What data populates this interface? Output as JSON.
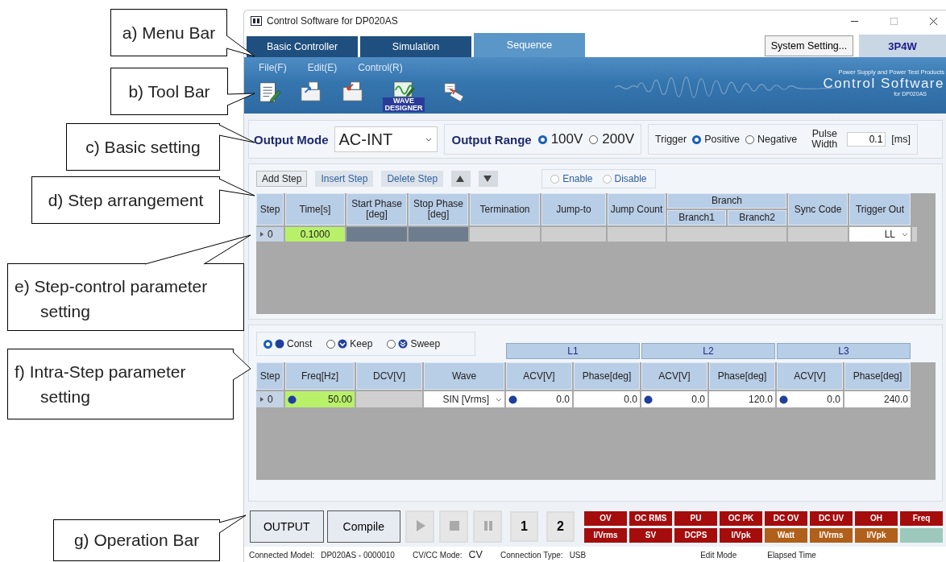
{
  "callouts": [
    {
      "label": "a) Menu Bar",
      "kind": "a"
    },
    {
      "label": "b) Tool Bar",
      "kind": "b"
    },
    {
      "label": "c) Basic setting",
      "kind": "c"
    },
    {
      "label": "d) Step arrangement",
      "kind": "d"
    },
    {
      "label": "e) Step-control parameter setting",
      "kind": "e"
    },
    {
      "label": "f) Intra-Step parameter setting",
      "kind": "f"
    },
    {
      "label": "g) Operation Bar",
      "kind": "g"
    }
  ],
  "window": {
    "title": "Control Software for DP020AS"
  },
  "tabs": [
    {
      "label": "Basic Controller",
      "selected": false
    },
    {
      "label": "Simulation",
      "selected": false
    },
    {
      "label": "Sequence",
      "selected": true
    }
  ],
  "system_setting_button": "System Setting...",
  "wiring_badge": "3P4W",
  "menu": [
    "File(F)",
    "Edit(E)",
    "Control(R)"
  ],
  "toolbar": [
    {
      "kind": "new"
    },
    {
      "kind": "open"
    },
    {
      "kind": "save"
    },
    {
      "kind": "wave",
      "caption": "WAVE DESIGNER"
    },
    {
      "kind": "transfer"
    }
  ],
  "logo": {
    "tagline": "Power Supply and Power Test Products",
    "name": "Control Software",
    "sub": "for DP020AS"
  },
  "basic_setting": {
    "output_mode_label": "Output Mode",
    "output_mode_value": "AC-INT",
    "output_range_label": "Output Range",
    "ranges": [
      {
        "label": "100V",
        "selected": true
      },
      {
        "label": "200V",
        "selected": false
      }
    ],
    "trigger_label": "Trigger",
    "triggers": [
      {
        "label": "Positive",
        "selected": true
      },
      {
        "label": "Negative",
        "selected": false
      }
    ],
    "pulse_width_label": "Pulse Width",
    "pulse_width_value": "0.1",
    "pulse_width_unit": "[ms]"
  },
  "step_arrangement": {
    "buttons": [
      {
        "label": "Add Step",
        "kind": "raised"
      },
      {
        "label": "Insert Step",
        "kind": "flat"
      },
      {
        "label": "Delete Step",
        "kind": "flat"
      }
    ],
    "move_buttons": [
      {
        "kind": "up"
      },
      {
        "kind": "down"
      }
    ],
    "sync_disabled": true,
    "sync_options": [
      {
        "label": "Enable",
        "selected": false
      },
      {
        "label": "Disable",
        "selected": false
      }
    ]
  },
  "step_table": {
    "columns": [
      {
        "label": "Step"
      },
      {
        "label": "Time[s]"
      },
      {
        "label": "Start Phase [deg]"
      },
      {
        "label": "Stop Phase [deg]"
      },
      {
        "label": "Termination"
      },
      {
        "label": "Jump-to"
      },
      {
        "label": "Jump Count"
      },
      {
        "label": "Branch",
        "children": [
          "Branch1",
          "Branch2"
        ]
      },
      {
        "label": "Sync Code"
      },
      {
        "label": "Trigger Out"
      }
    ],
    "rows": [
      {
        "cells": [
          {
            "kind": "step",
            "value": "0"
          },
          {
            "kind": "param",
            "selected": true,
            "value": "0.1000"
          },
          {
            "kind": "blocked"
          },
          {
            "kind": "blocked"
          },
          {
            "kind": "empty"
          },
          {
            "kind": "empty"
          },
          {
            "kind": "empty"
          },
          {
            "kind": "empty"
          },
          {
            "kind": "empty"
          },
          {
            "kind": "select",
            "value": "LL"
          },
          {
            "kind": "empty"
          }
        ]
      }
    ]
  },
  "intra_step": {
    "modes": [
      {
        "label": "Const",
        "kind": "const",
        "selected": true
      },
      {
        "label": "Keep",
        "kind": "keep",
        "selected": false
      },
      {
        "label": "Sweep",
        "kind": "sweep",
        "selected": false
      }
    ],
    "phases": [
      "L1",
      "L2",
      "L3"
    ],
    "columns": [
      "Step",
      "Freq[Hz]",
      "DCV[V]",
      "Wave",
      "ACV[V]",
      "Phase[deg]",
      "ACV[V]",
      "Phase[deg]",
      "ACV[V]",
      "Phase[deg]"
    ],
    "rows": [
      {
        "cells": [
          {
            "kind": "step",
            "value": "0"
          },
          {
            "kind": "const",
            "selected": true,
            "value": "50.00"
          },
          {
            "kind": "empty"
          },
          {
            "kind": "select",
            "value": "SIN [Vrms]"
          },
          {
            "kind": "const",
            "selected": false,
            "value": "0.0"
          },
          {
            "kind": "param",
            "selected": false,
            "value": "0.0"
          },
          {
            "kind": "const",
            "selected": false,
            "value": "0.0"
          },
          {
            "kind": "param",
            "selected": false,
            "value": "120.0"
          },
          {
            "kind": "const",
            "selected": false,
            "value": "0.0"
          },
          {
            "kind": "param",
            "selected": false,
            "value": "240.0"
          }
        ]
      }
    ]
  },
  "operation_bar": {
    "buttons": [
      "OUTPUT",
      "Compile"
    ],
    "transport": [
      {
        "kind": "play"
      },
      {
        "kind": "stop"
      },
      {
        "kind": "pause"
      }
    ],
    "memory": [
      "1",
      "2"
    ],
    "alarm_rows": [
      {
        "items": [
          {
            "label": "OV",
            "color": "#a50d0d"
          },
          {
            "label": "OC RMS",
            "color": "#a50d0d"
          },
          {
            "label": "PU",
            "color": "#a50d0d"
          },
          {
            "label": "OC PK",
            "color": "#a50d0d"
          },
          {
            "label": "DC OV",
            "color": "#a50d0d"
          },
          {
            "label": "DC UV",
            "color": "#a50d0d"
          },
          {
            "label": "OH",
            "color": "#a50d0d"
          },
          {
            "label": "Freq",
            "color": "#a50d0d"
          }
        ]
      },
      {
        "items": [
          {
            "label": "I/Vrms",
            "color": "#a50d0d"
          },
          {
            "label": "SV",
            "color": "#a50d0d"
          },
          {
            "label": "DCPS",
            "color": "#a50d0d"
          },
          {
            "label": "I/Vpk",
            "color": "#a50d0d"
          },
          {
            "label": "Watt",
            "color": "#b0601a"
          },
          {
            "label": "I/Vrms",
            "color": "#b0601a"
          },
          {
            "label": "I/Vpk",
            "color": "#b0601a"
          }
        ]
      }
    ]
  },
  "status_bar": [
    {
      "label": "Connected Model:",
      "value": "DP020AS - 0000010"
    },
    {
      "label": "CV/CC Mode:",
      "value": "CV",
      "kind": "large"
    },
    {
      "label": "Connection Type:",
      "value": "USB"
    },
    {
      "label": "Edit Mode"
    },
    {
      "label": "Elapsed Time"
    }
  ]
}
